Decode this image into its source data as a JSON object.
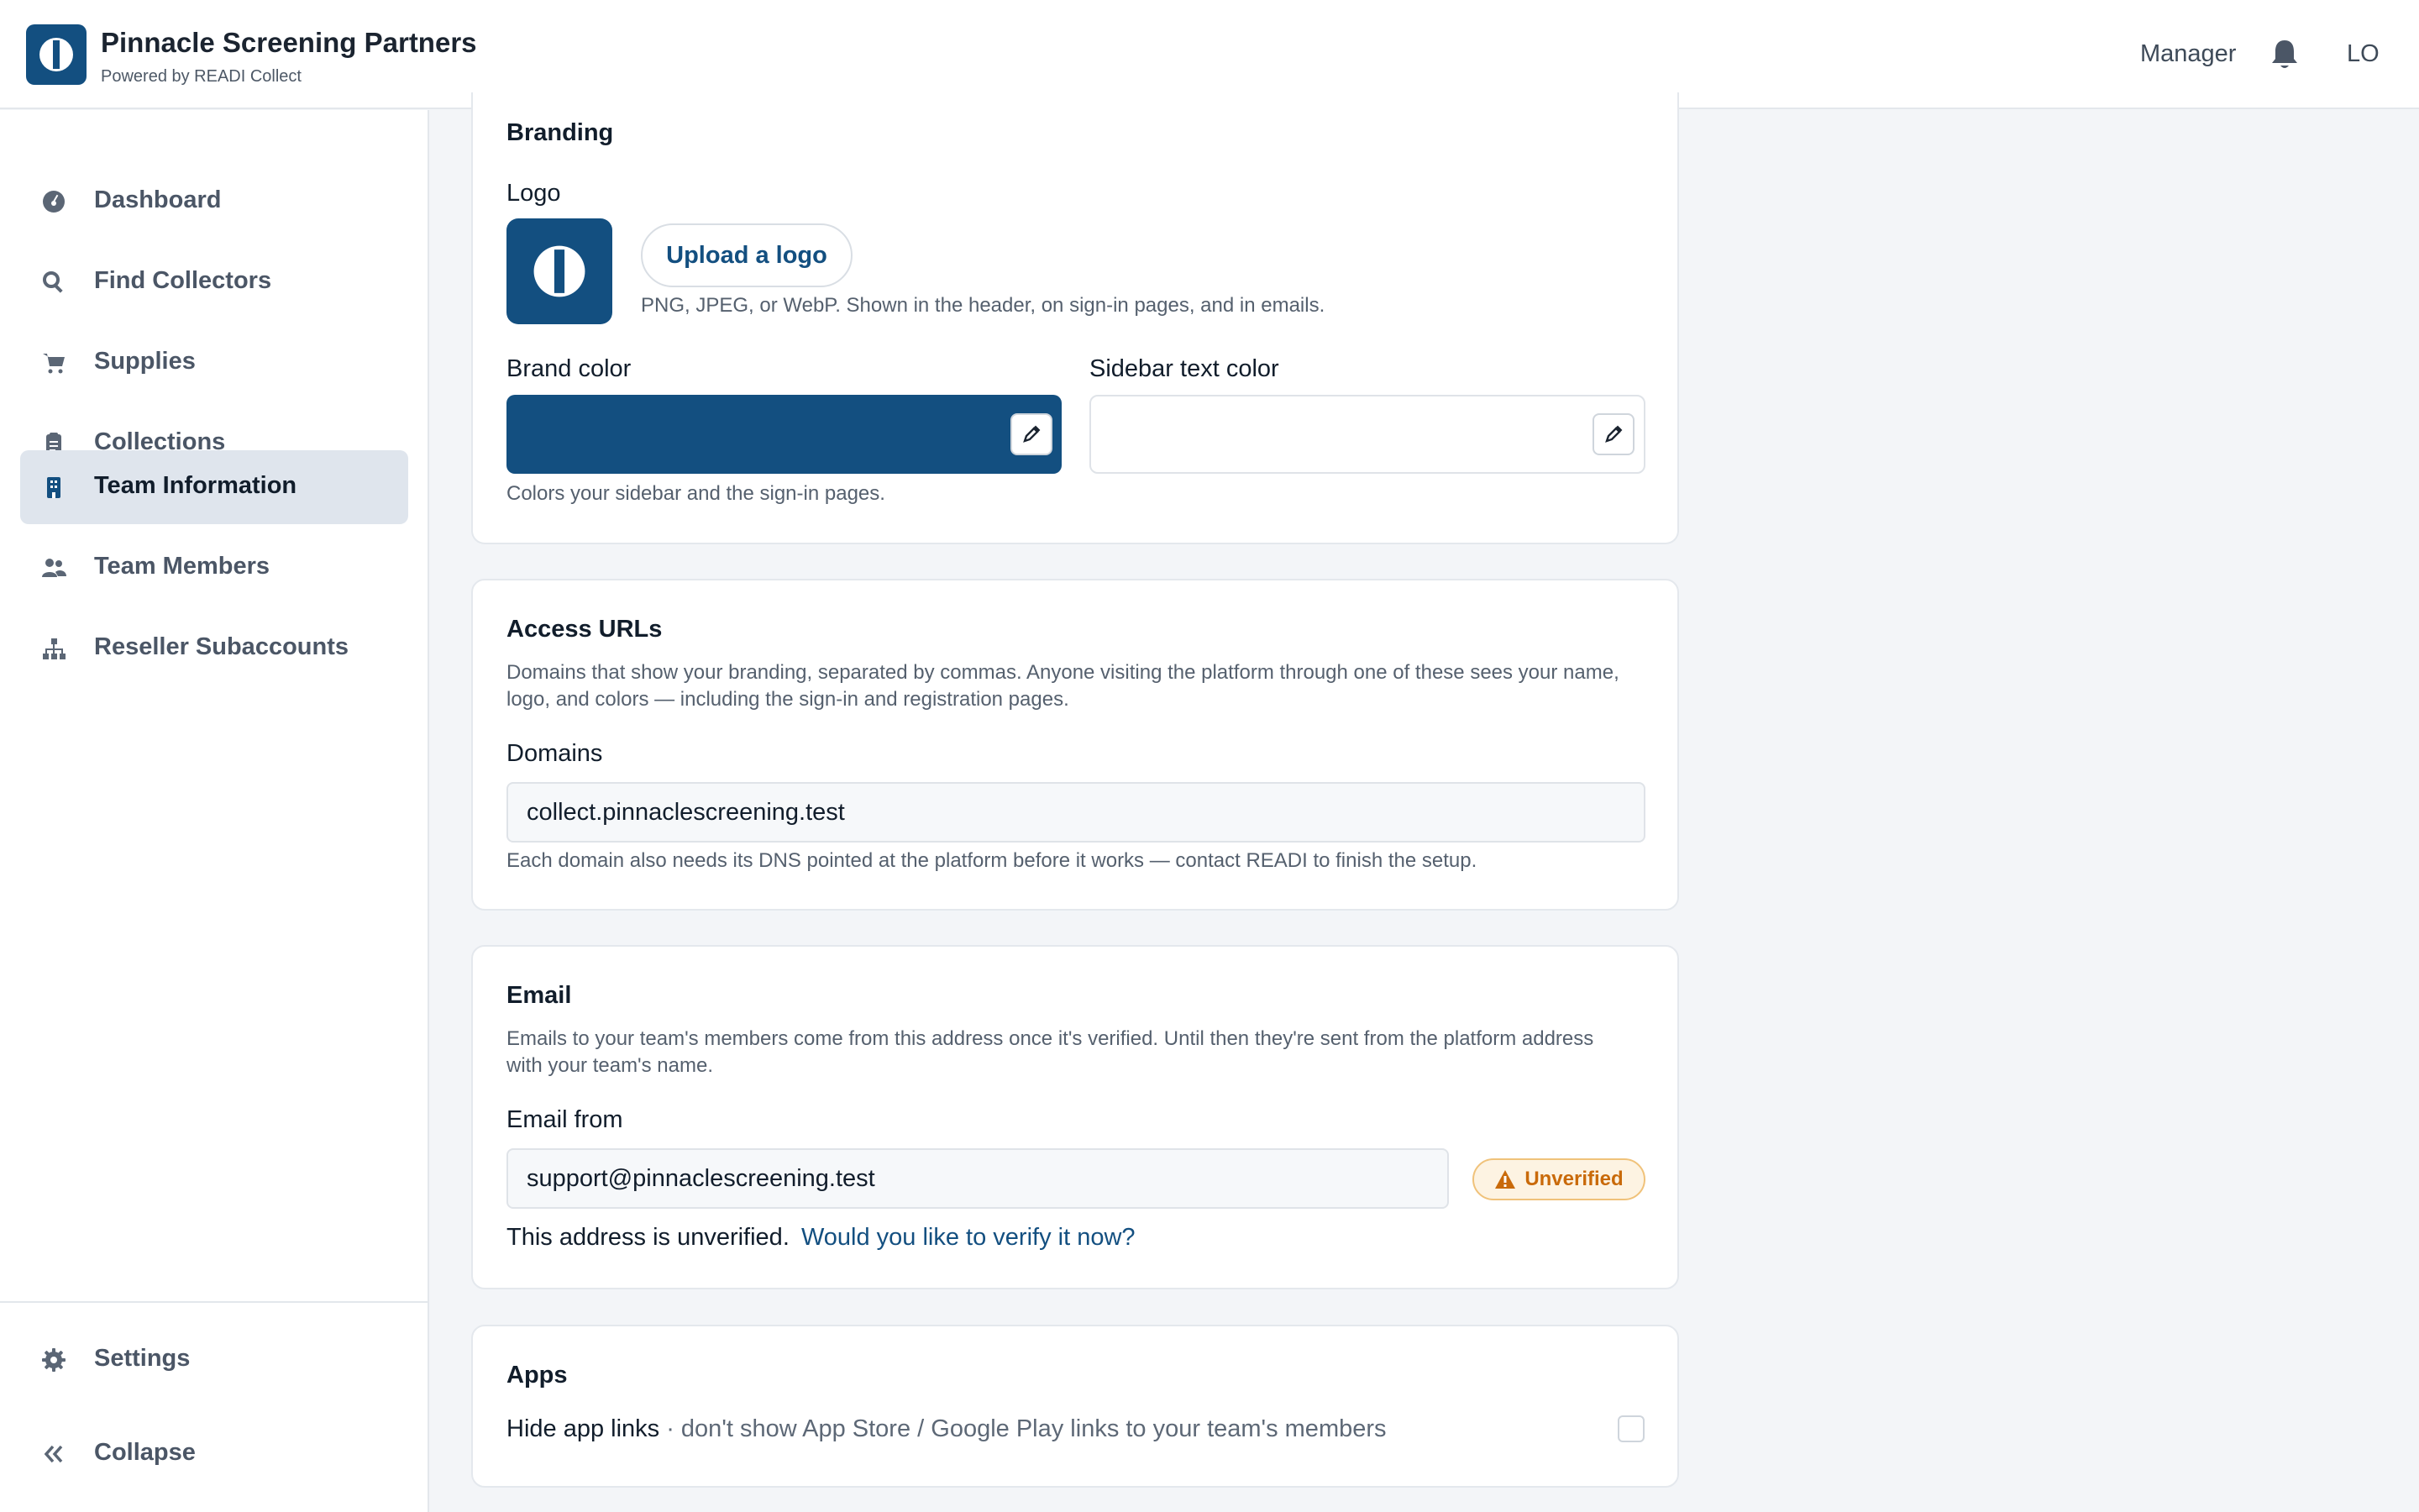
{
  "header": {
    "app_name": "Pinnacle Screening Partners",
    "powered_by": "Powered by READI Collect",
    "role": "Manager",
    "user_initials": "LO"
  },
  "sidebar": {
    "items": [
      {
        "label": "Dashboard",
        "icon": "dashboard-icon"
      },
      {
        "label": "Find Collectors",
        "icon": "search-icon"
      },
      {
        "label": "Supplies",
        "icon": "cart-icon"
      },
      {
        "label": "Collections",
        "icon": "clipboard-icon"
      },
      {
        "label": "Team Information",
        "icon": "building-icon",
        "active": true
      },
      {
        "label": "Team Members",
        "icon": "users-icon"
      },
      {
        "label": "Reseller Subaccounts",
        "icon": "hierarchy-icon"
      }
    ],
    "settings_label": "Settings",
    "collapse_label": "Collapse"
  },
  "branding": {
    "title": "Branding",
    "logo_label": "Logo",
    "upload_label": "Upload a logo",
    "logo_help": "PNG, JPEG, or WebP. Shown in the header, on sign-in pages, and in emails.",
    "brand_color_label": "Brand color",
    "brand_color": "#134f80",
    "sidebar_text_color_label": "Sidebar text color",
    "sidebar_text_color": "#ffffff",
    "colors_help": "Colors your sidebar and the sign-in pages."
  },
  "access": {
    "title": "Access URLs",
    "description": "Domains that show your branding, separated by commas. Anyone visiting the platform through one of these sees your name, logo, and colors — including the sign-in and registration pages.",
    "domains_label": "Domains",
    "domains_value": "collect.pinnaclescreening.test",
    "dns_help": "Each domain also needs its DNS pointed at the platform before it works — contact READI to finish the setup."
  },
  "email": {
    "title": "Email",
    "description": "Emails to your team's members come from this address once it's verified. Until then they're sent from the platform address with your team's name.",
    "from_label": "Email from",
    "from_value": "support@pinnaclescreening.test",
    "status_badge": "Unverified",
    "unverified_text": "This address is unverified.",
    "verify_link": "Would you like to verify it now?"
  },
  "apps": {
    "title": "Apps",
    "hide_label": "Hide app links",
    "hide_desc": " · don't show App Store / Google Play links to your team's members",
    "hide_checked": false
  },
  "colors": {
    "brand": "#134f80",
    "warning": "#c96a0a"
  }
}
